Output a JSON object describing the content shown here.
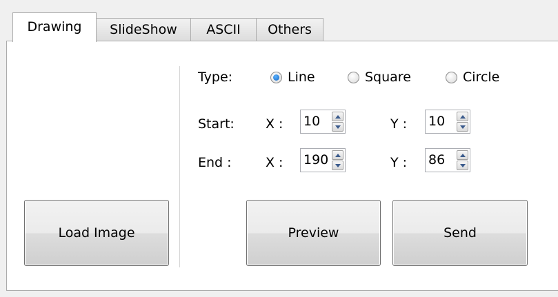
{
  "tabs": [
    {
      "label": "Drawing",
      "active": true
    },
    {
      "label": "SlideShow",
      "active": false
    },
    {
      "label": "ASCII",
      "active": false
    },
    {
      "label": "Others",
      "active": false
    }
  ],
  "drawing": {
    "load_image_label": "Load Image",
    "type_label": "Type:",
    "shape_options": [
      {
        "label": "Line",
        "selected": true
      },
      {
        "label": "Square",
        "selected": false
      },
      {
        "label": "Circle",
        "selected": false
      }
    ],
    "start_label": "Start:",
    "end_label": "End :",
    "x_label": "X :",
    "y_label": "Y :",
    "start": {
      "x": "10",
      "y": "10"
    },
    "end": {
      "x": "190",
      "y": "86"
    },
    "preview_label": "Preview",
    "send_label": "Send"
  },
  "colors": {
    "window_bg": "#f0f0f0",
    "panel_bg": "#ffffff",
    "border": "#acacac",
    "radio_accent": "#1565c0"
  }
}
